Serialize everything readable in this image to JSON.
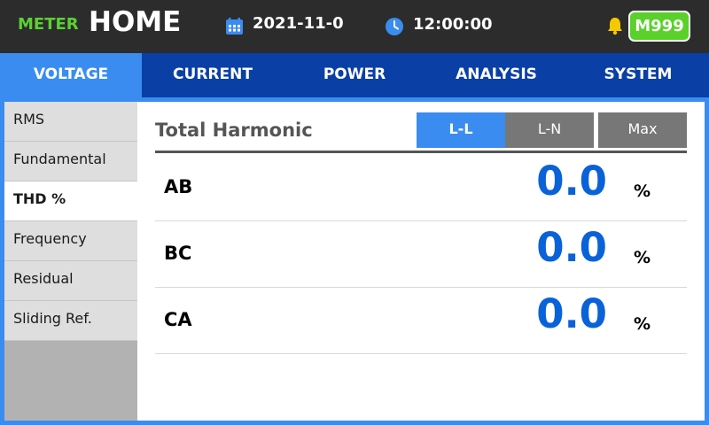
{
  "header": {
    "brand": "METER",
    "title": "HOME",
    "date": "2021-11-0",
    "time": "12:00:00",
    "badge": "M999",
    "colors": {
      "background": "#2c2c2c",
      "brand": "#5cd132",
      "badge": "#5ad12a"
    },
    "icons": {
      "date": "calendar-icon",
      "time": "clock-icon",
      "alert": "bell-icon"
    }
  },
  "tabs": [
    {
      "label": "VOLTAGE",
      "active": true
    },
    {
      "label": "CURRENT",
      "active": false
    },
    {
      "label": "POWER",
      "active": false
    },
    {
      "label": "ANALYSIS",
      "active": false
    },
    {
      "label": "SYSTEM",
      "active": false
    }
  ],
  "sidebar": {
    "items": [
      {
        "label": "RMS",
        "active": false
      },
      {
        "label": "Fundamental",
        "active": false
      },
      {
        "label": "THD %",
        "active": true
      },
      {
        "label": "Frequency",
        "active": false
      },
      {
        "label": "Residual",
        "active": false
      },
      {
        "label": "Sliding Ref.",
        "active": false
      }
    ]
  },
  "content": {
    "title": "Total Harmonic",
    "modes": [
      {
        "label": "L-L",
        "active": true
      },
      {
        "label": "L-N",
        "active": false
      },
      {
        "label": "Max",
        "active": false
      }
    ],
    "rows": [
      {
        "label": "AB",
        "value": "0.0",
        "unit": "%"
      },
      {
        "label": "BC",
        "value": "0.0",
        "unit": "%"
      },
      {
        "label": "CA",
        "value": "0.0",
        "unit": "%"
      }
    ],
    "colors": {
      "accent": "#3a8cf0",
      "value": "#0a62d8",
      "nav": "#0a3fa5"
    }
  }
}
